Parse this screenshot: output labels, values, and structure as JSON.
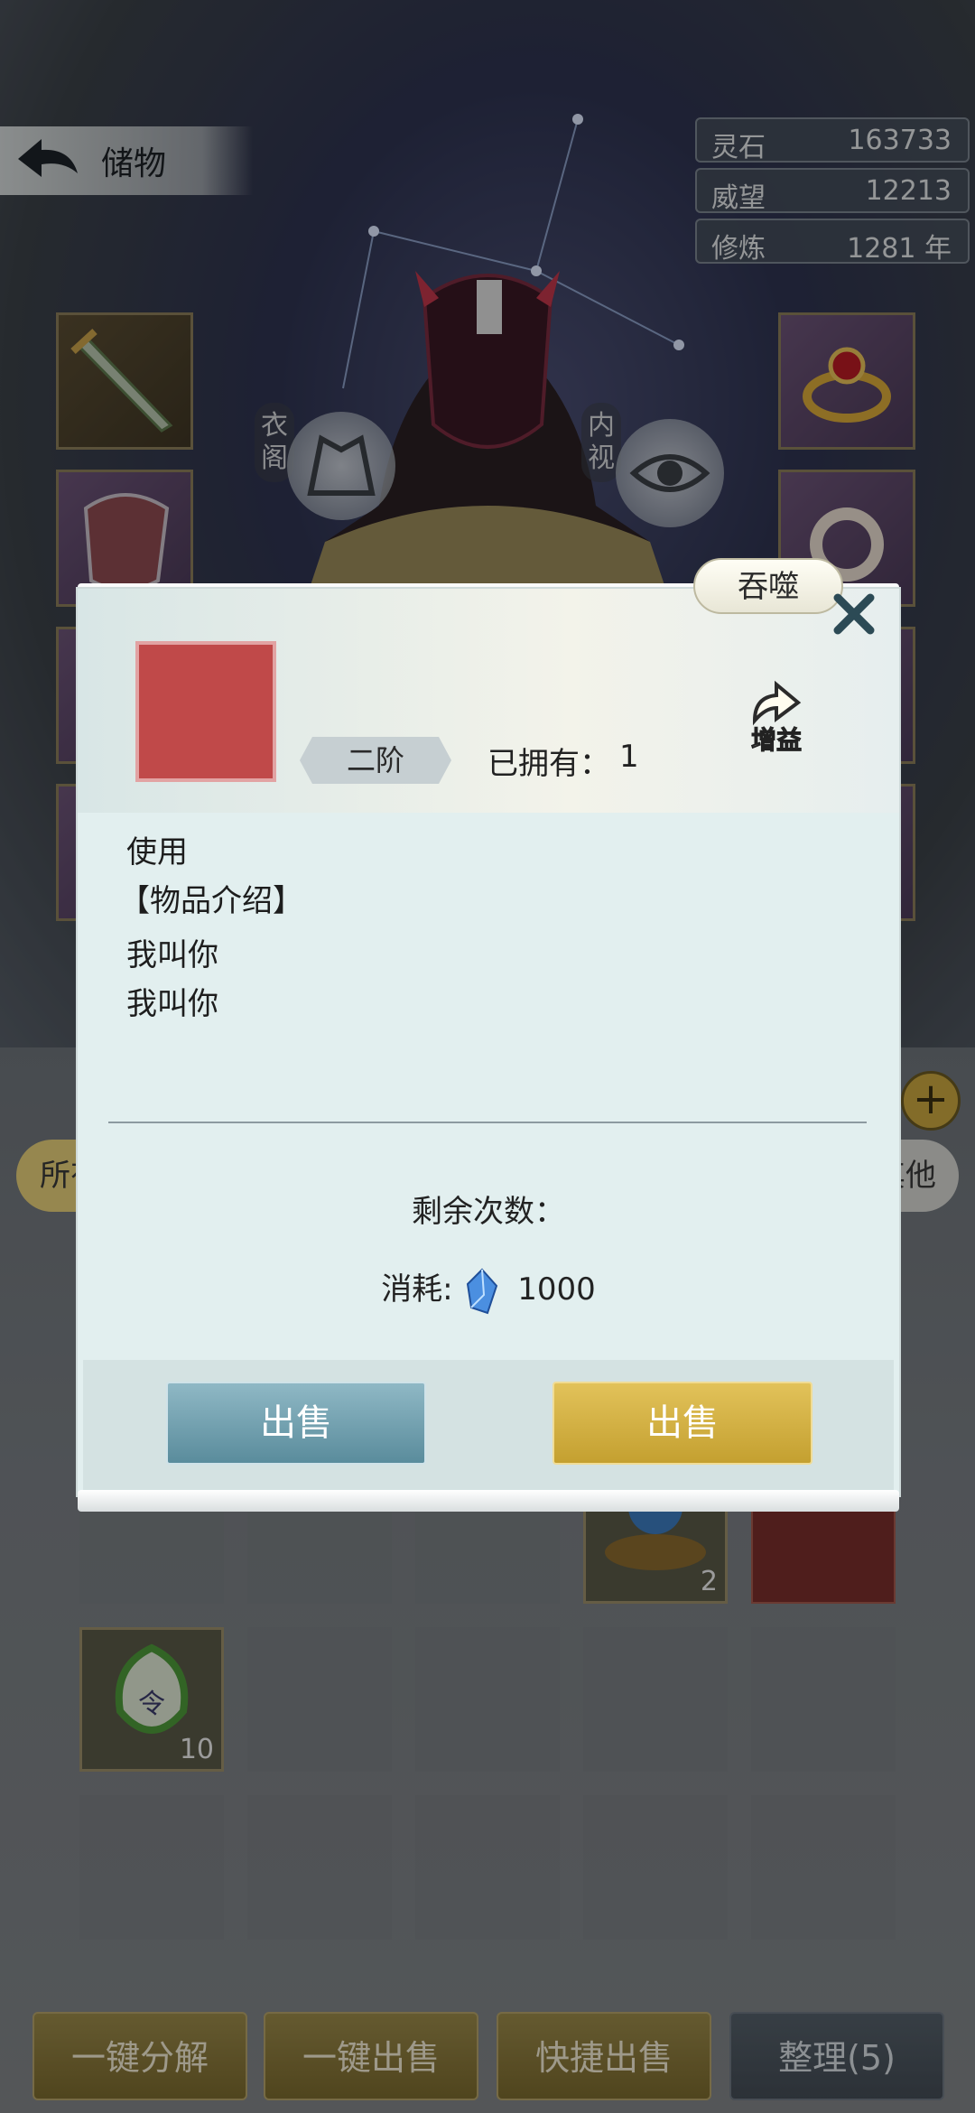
{
  "header": {
    "title": "储物"
  },
  "resources": [
    {
      "label": "灵石",
      "value": "163733"
    },
    {
      "label": "威望",
      "value": "12213"
    },
    {
      "label": "修炼",
      "value": "1281 年"
    }
  ],
  "character": {
    "left_button": "衣阁",
    "right_button": "内视"
  },
  "tabs": {
    "first": "所有",
    "last": "其他"
  },
  "inventory": {
    "qty_orb": "2",
    "qty_token": "10"
  },
  "modal": {
    "devour_label": "吞噬",
    "tier": "二阶",
    "owned_label": "已拥有：",
    "owned_value": "1",
    "buff_label": "增益",
    "desc_lines": [
      "使用",
      "【物品介绍】",
      "我叫你",
      "我叫你"
    ],
    "remaining_label": "剩余次数：",
    "cost_label": "消耗:",
    "cost_value": "1000",
    "sell_left": "出售",
    "sell_right": "出售"
  },
  "bottom_buttons": [
    "一键分解",
    "一键出售",
    "快捷出售",
    "整理(5)"
  ]
}
